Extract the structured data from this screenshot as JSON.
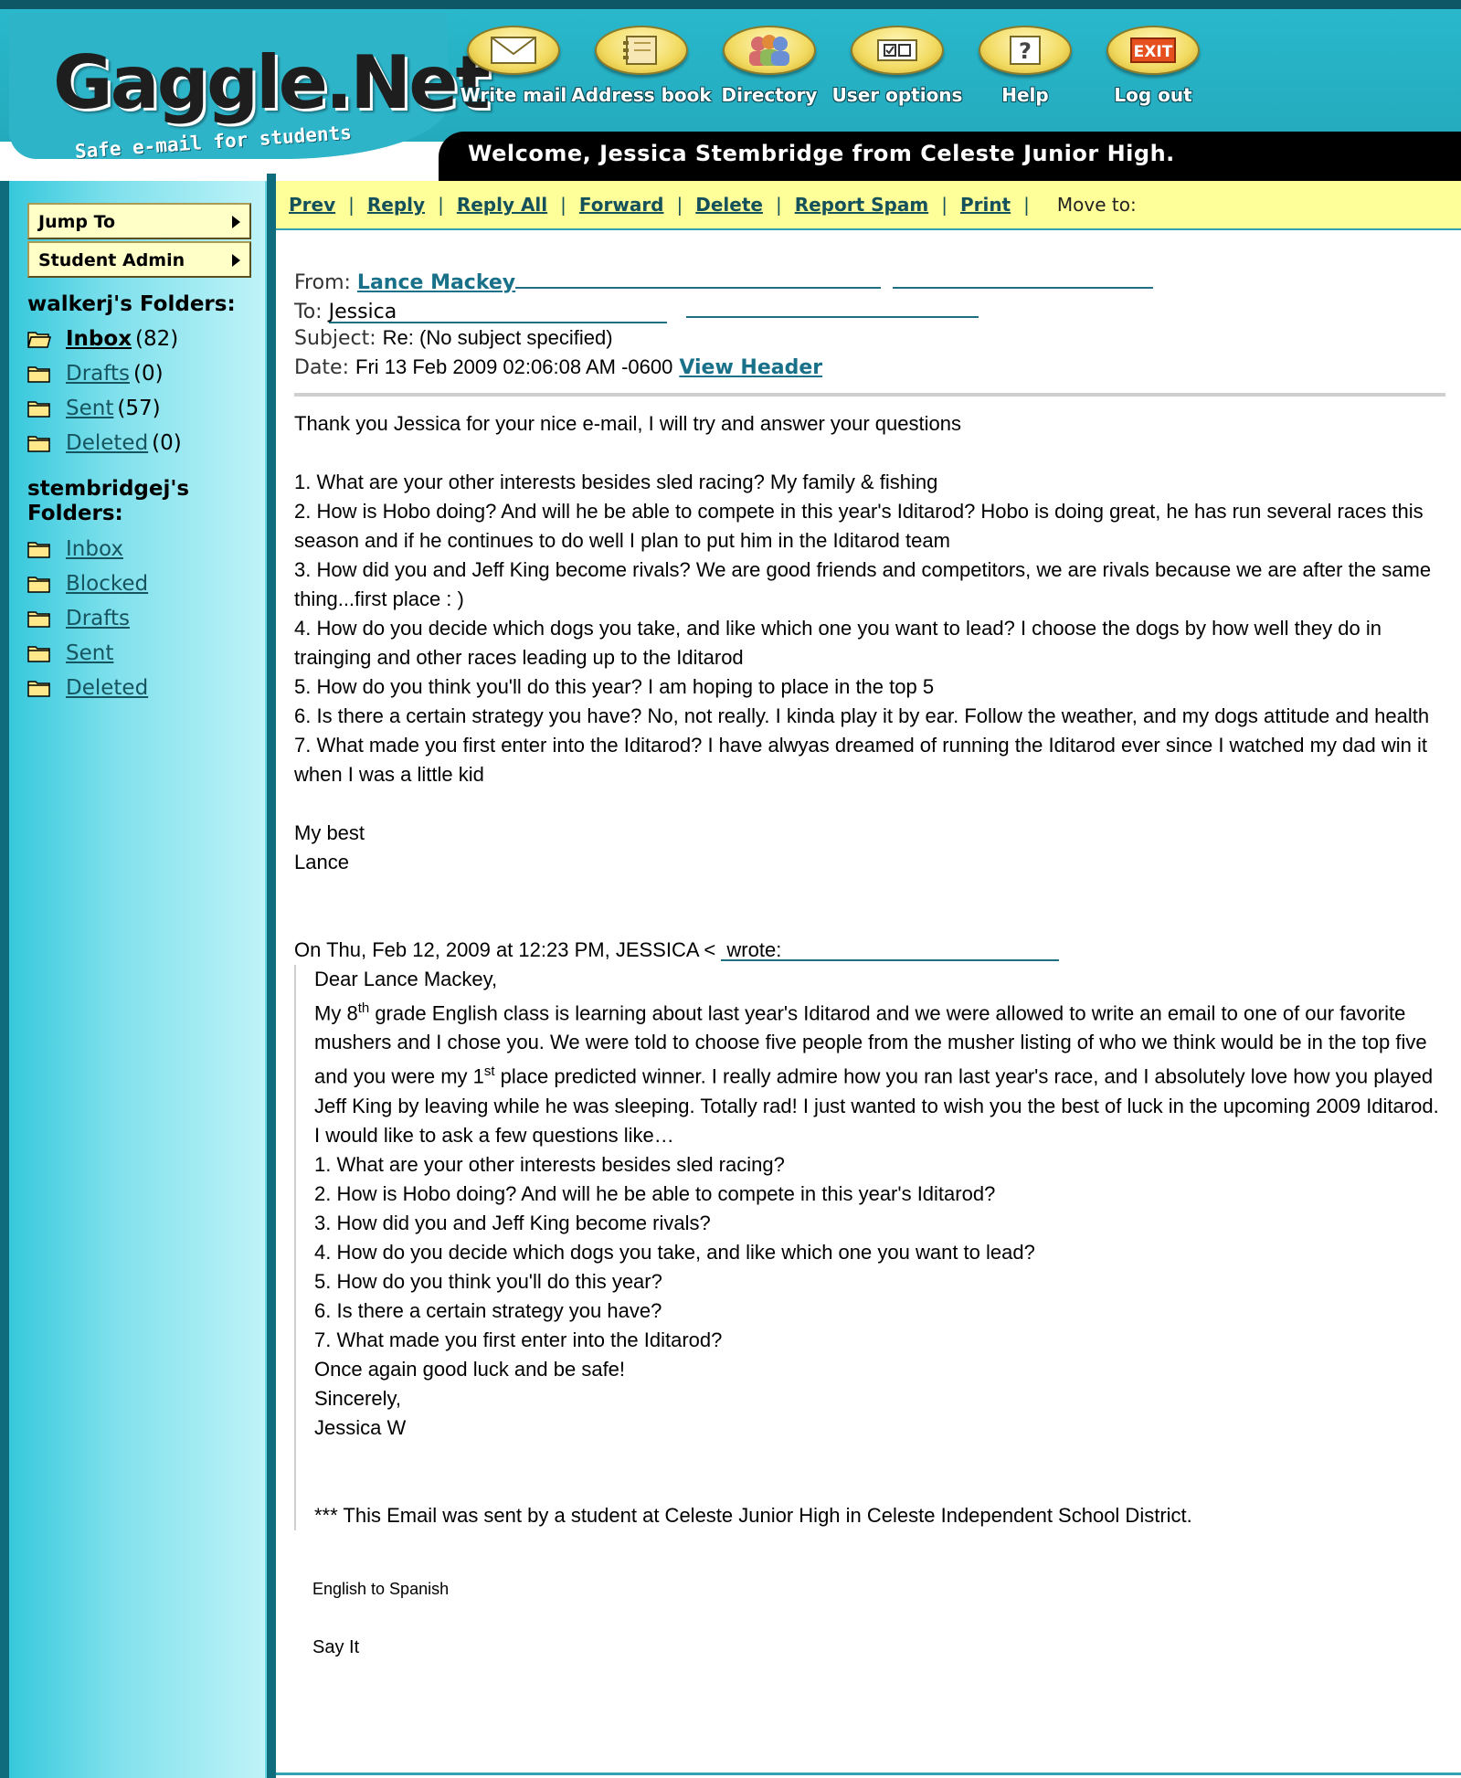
{
  "app": {
    "logo": "Gaggle.Net",
    "tagline": "Safe e-mail for students",
    "welcome": "Welcome, Jessica Stembridge from Celeste Junior High."
  },
  "nav": [
    {
      "label": "Write mail",
      "icon": "envelope-icon"
    },
    {
      "label": "Address book",
      "icon": "address-book-icon"
    },
    {
      "label": "Directory",
      "icon": "people-icon"
    },
    {
      "label": "User options",
      "icon": "options-icon"
    },
    {
      "label": "Help",
      "icon": "help-icon"
    },
    {
      "label": "Log out",
      "icon": "exit-icon",
      "icon_text": "EXIT"
    }
  ],
  "sidebar": {
    "jump_to": "Jump To",
    "student_admin": "Student Admin",
    "group1": {
      "title": "walkerj's Folders:",
      "folders": [
        {
          "name": "Inbox ",
          "count": "(82)",
          "active": true
        },
        {
          "name": "Drafts ",
          "count": "(0)"
        },
        {
          "name": "Sent ",
          "count": "(57)"
        },
        {
          "name": "Deleted ",
          "count": "(0)"
        }
      ]
    },
    "group2": {
      "title": "stembridgej's Folders:",
      "folders": [
        {
          "name": "Inbox "
        },
        {
          "name": "Blocked "
        },
        {
          "name": "Drafts "
        },
        {
          "name": "Sent "
        },
        {
          "name": "Deleted "
        }
      ]
    }
  },
  "toolbar": {
    "prev": "Prev",
    "reply": "Reply",
    "reply_all": "Reply All",
    "forward": "Forward",
    "delete": "Delete",
    "report_spam": "Report Spam",
    "print": "Print",
    "sep": "|",
    "move_to": "Move to:"
  },
  "message": {
    "from_label": "From:",
    "from_name": "Lance Mackey",
    "to_label": "To:",
    "to_name": "Jessica",
    "subject_label": "Subject:",
    "subject": "Re: (No subject specified)",
    "date_label": "Date:",
    "date": "Fri 13 Feb 2009 02:06:08 AM -0600",
    "view_header": "View Header",
    "body": [
      "Thank you Jessica for your nice e-mail, I will try and answer your questions",
      "",
      "1. What are your other interests besides sled racing? My family & fishing",
      "2. How is Hobo doing? And will he be able to compete in this year's Iditarod? Hobo is doing great, he has run several races this season and if he continues to do well I plan to put him in the Iditarod team",
      "3. How did you and Jeff King become rivals? We are good friends and competitors, we are rivals because we are after the same thing...first place : )",
      "4. How do you decide which dogs you take, and like which one you want to lead? I choose the dogs by how well they do in trainging and other races leading up to the Iditarod",
      "5. How do you think you'll do this year? I am hoping to place in the top 5",
      "6. Is there a certain strategy you have? No, not really. I kinda play it by ear. Follow the weather, and my dogs attitude and health",
      "7. What made you first enter into the Iditarod? I have alwyas dreamed of running the Iditarod ever since I watched my dad win it when I was a little kid",
      "",
      "My best",
      "Lance"
    ],
    "quote_intro_prefix": "On Thu, Feb 12, 2009 at 12:23 PM, JESSICA <",
    "quote_intro_link": "wrote:",
    "quote": {
      "greeting": "Dear Lance Mackey,",
      "p1_a": "My 8",
      "p1_sup1": "th",
      "p1_b": " grade English class is learning about last year's Iditarod and we were allowed to write an email to one of our favorite mushers and I chose you. We were told to choose five people from the musher listing of who we think would be in the top five and you were my 1",
      "p1_sup2": "st",
      "p1_c": " place predicted winner. I really admire how you ran last year's race, and I absolutely love how you played Jeff King by leaving while he was sleeping. Totally rad! I just wanted to wish you the best of luck in the upcoming 2009 Iditarod.",
      "lines": [
        "I would like to ask a few questions like…",
        "1. What are your other interests besides sled racing?",
        "2. How is Hobo doing? And will he be able to compete in this year's Iditarod?",
        "3. How did you and Jeff King become rivals?",
        "4. How do you decide which dogs you take, and like which one you want to lead?",
        "5. How do you think you'll do this year?",
        "6. Is there a certain strategy you have?",
        "7. What made you first enter into the Iditarod?",
        "Once again good luck and be safe!",
        "Sincerely,",
        "Jessica W"
      ],
      "footer": "*** This Email was sent by a student at Celeste Junior High in Celeste Independent School District."
    },
    "translate": "English to Spanish",
    "say_it": "Say It"
  }
}
